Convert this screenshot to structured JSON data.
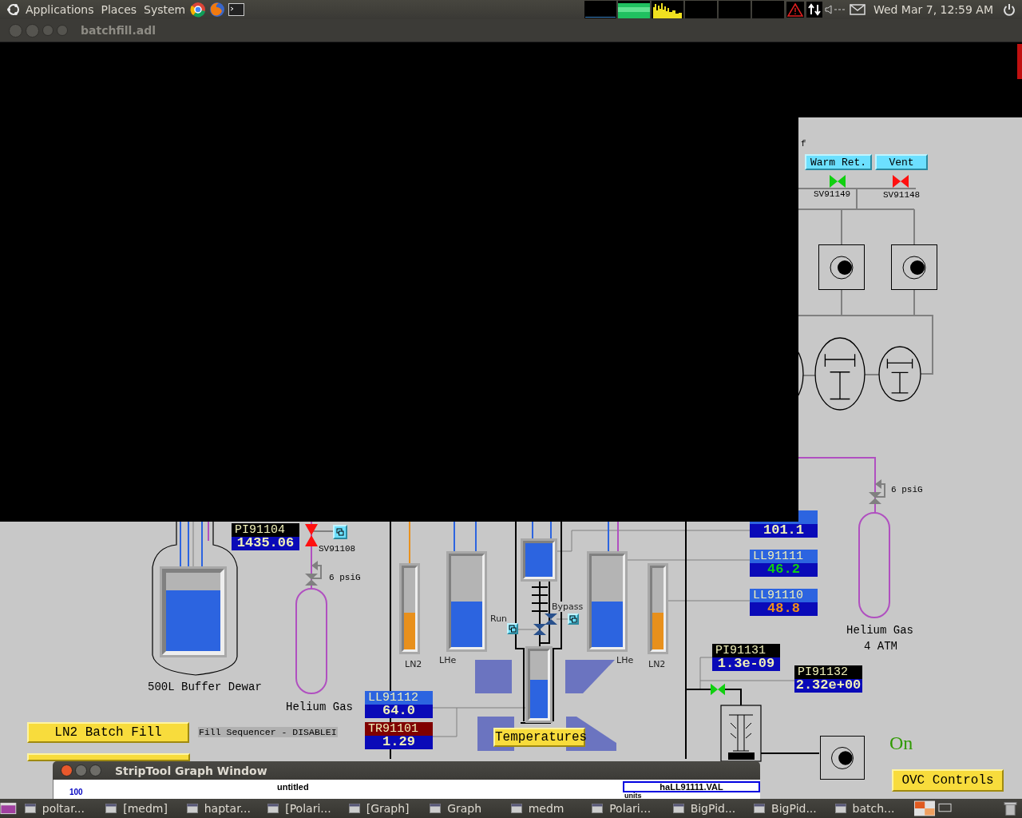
{
  "top_panel": {
    "menus": [
      "Applications",
      "Places",
      "System"
    ],
    "clock": "Wed Mar  7, 12:59 AM"
  },
  "window": {
    "title": "batchfill.adl"
  },
  "buttons": [
    {
      "label": "Warm Ret.",
      "kind": "cyan"
    },
    {
      "label": "Vent",
      "kind": "cyan"
    },
    {
      "label": "LN2 Batch Fill",
      "kind": "yellow"
    },
    {
      "kind": "yellow"
    },
    {
      "label": "Temperatures",
      "kind": "yellow"
    },
    {
      "label": "OVC Controls",
      "kind": "yellow"
    }
  ],
  "valves": [
    {
      "name": "SV91149",
      "open": true,
      "kind": "horizontal"
    },
    {
      "name": "SV91148",
      "open": false,
      "kind": "horizontal"
    },
    {
      "name": "SV91108",
      "open": false,
      "kind": "vertical"
    },
    {
      "open": true,
      "kind": "horizontal"
    }
  ],
  "regulators": [
    {
      "setting": "6 psiG"
    },
    {
      "setting": "6 psiG"
    }
  ],
  "gauges": [
    {
      "kind": "lhe",
      "level": 0.78
    },
    {
      "kind": "ln2",
      "level": 0.45,
      "label": "LN2"
    },
    {
      "kind": "lhe",
      "level": 0.5,
      "label": "LHe"
    },
    {
      "kind": "lhe",
      "level": 1.0
    },
    {
      "kind": "lhe",
      "level": 0.57
    },
    {
      "kind": "lhe",
      "level": 0.5,
      "label": "LHe"
    },
    {
      "kind": "ln2",
      "level": 0.45,
      "label": "LN2"
    }
  ],
  "readouts": [
    {
      "kind": "pressure",
      "name": "PI91104",
      "value": "1435.06",
      "color": "#f0f0b8"
    },
    {
      "kind": "level",
      "value": "101.1",
      "color": "#f0f0b8"
    },
    {
      "kind": "level",
      "name": "LL91111",
      "value": "46.2",
      "color": "#10d010"
    },
    {
      "kind": "level",
      "name": "LL91110",
      "value": "48.8",
      "color": "#f09018"
    },
    {
      "kind": "level",
      "name": "LL91112",
      "value": "64.0",
      "color": "#f0f0b8"
    },
    {
      "kind": "temperature",
      "name": "TR91101",
      "value": "1.29",
      "color": "#f0f0b8"
    },
    {
      "kind": "pressure",
      "name": "PI91131",
      "value": "1.3e-09",
      "color": "#f0f0b8"
    },
    {
      "kind": "pressure",
      "name": "PI91132",
      "value": "2.32e+00",
      "color": "#f0f0b8"
    }
  ],
  "labels": [
    "f",
    "500L Buffer Dewar",
    "Helium Gas",
    "Helium Gas",
    "4 ATM",
    "Run",
    "Bypass"
  ],
  "pump_status": "On",
  "sequencer_status": "Fill Sequencer - DISABLEI",
  "striptool": {
    "title": "StripTool Graph Window",
    "graph_title": "untitled",
    "y_max": "100",
    "legend": "haLL91111.VAL",
    "units": "units"
  },
  "taskbar": [
    "poltar...",
    "[medm]",
    "haptar...",
    "[Polari...",
    "[Graph]",
    "Graph",
    "medm",
    "Polari...",
    "BigPid...",
    "BigPid...",
    "batch..."
  ]
}
